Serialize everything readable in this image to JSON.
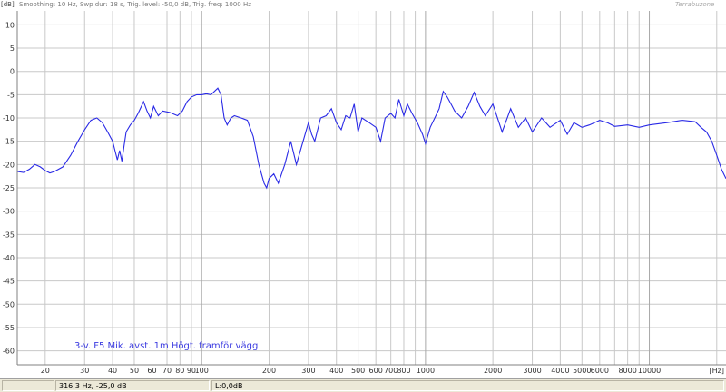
{
  "header": {
    "y_unit": "[dB]",
    "settings": "Smoothing: 10 Hz, Swp dur: 18 s, Trig. level: -50,0 dB, Trig. freq: 1000 Hz",
    "brand": "Terrabuzone"
  },
  "status": {
    "cursor": "316,3 Hz, -25,0 dB",
    "level": "L:0,0dB"
  },
  "colors": {
    "trace": "#2a2ae6",
    "grid": "#c8c8c8",
    "annotation": "#3a3ae0"
  },
  "chart_data": {
    "type": "line",
    "title": "",
    "annotation": "3-v. F5 Mik. avst. 1m Högt. framför vägg",
    "xlabel": "[Hz]",
    "ylabel": "[dB]",
    "x_scale": "log",
    "xlim": [
      15,
      22000
    ],
    "ylim": [
      -63,
      13
    ],
    "grid": true,
    "y_ticks": [
      10,
      5,
      0,
      -5,
      -10,
      -15,
      -20,
      -25,
      -30,
      -35,
      -40,
      -45,
      -50,
      -55,
      -60
    ],
    "x_ticks": [
      {
        "value": 20,
        "label": "20"
      },
      {
        "value": 30,
        "label": "30"
      },
      {
        "value": 40,
        "label": "40"
      },
      {
        "value": 50,
        "label": "50"
      },
      {
        "value": 60,
        "label": "60"
      },
      {
        "value": 70,
        "label": "70"
      },
      {
        "value": 80,
        "label": "80"
      },
      {
        "value": 90,
        "label": "90"
      },
      {
        "value": 100,
        "label": "100"
      },
      {
        "value": 200,
        "label": "200"
      },
      {
        "value": 300,
        "label": "300"
      },
      {
        "value": 400,
        "label": "400"
      },
      {
        "value": 500,
        "label": "500"
      },
      {
        "value": 600,
        "label": "600"
      },
      {
        "value": 700,
        "label": "700"
      },
      {
        "value": 800,
        "label": "800"
      },
      {
        "value": 1000,
        "label": "1000"
      },
      {
        "value": 2000,
        "label": "2000"
      },
      {
        "value": 3000,
        "label": "3000"
      },
      {
        "value": 4000,
        "label": "4000"
      },
      {
        "value": 5000,
        "label": "5000"
      },
      {
        "value": 6000,
        "label": "6000"
      },
      {
        "value": 8000,
        "label": "8000"
      },
      {
        "value": 10000,
        "label": "10000"
      }
    ],
    "series": [
      {
        "points": [
          [
            15,
            -21.5
          ],
          [
            16,
            -21.7
          ],
          [
            17,
            -21
          ],
          [
            18,
            -20
          ],
          [
            19,
            -20.5
          ],
          [
            20,
            -21.3
          ],
          [
            21,
            -21.8
          ],
          [
            22,
            -21.5
          ],
          [
            24,
            -20.5
          ],
          [
            26,
            -18
          ],
          [
            28,
            -15
          ],
          [
            30,
            -12.5
          ],
          [
            32,
            -10.5
          ],
          [
            34,
            -10
          ],
          [
            36,
            -11
          ],
          [
            38,
            -13
          ],
          [
            40,
            -15
          ],
          [
            42,
            -19
          ],
          [
            43,
            -17
          ],
          [
            44,
            -19.3
          ],
          [
            45,
            -16
          ],
          [
            46,
            -13
          ],
          [
            48,
            -11.5
          ],
          [
            50,
            -10.5
          ],
          [
            52,
            -9
          ],
          [
            55,
            -6.5
          ],
          [
            57,
            -8.5
          ],
          [
            59,
            -10
          ],
          [
            61,
            -7.5
          ],
          [
            64,
            -9.5
          ],
          [
            67,
            -8.5
          ],
          [
            72,
            -8.8
          ],
          [
            78,
            -9.5
          ],
          [
            82,
            -8.5
          ],
          [
            86,
            -6.5
          ],
          [
            90,
            -5.5
          ],
          [
            95,
            -5
          ],
          [
            100,
            -5
          ],
          [
            105,
            -4.8
          ],
          [
            110,
            -5
          ],
          [
            118,
            -3.6
          ],
          [
            122,
            -5
          ],
          [
            126,
            -10
          ],
          [
            130,
            -11.5
          ],
          [
            135,
            -10
          ],
          [
            140,
            -9.5
          ],
          [
            150,
            -10
          ],
          [
            160,
            -10.5
          ],
          [
            170,
            -14
          ],
          [
            180,
            -20
          ],
          [
            190,
            -24
          ],
          [
            195,
            -25
          ],
          [
            200,
            -23
          ],
          [
            210,
            -22
          ],
          [
            220,
            -24
          ],
          [
            235,
            -20
          ],
          [
            250,
            -15
          ],
          [
            265,
            -20
          ],
          [
            280,
            -16
          ],
          [
            300,
            -11
          ],
          [
            310,
            -13.5
          ],
          [
            320,
            -15
          ],
          [
            340,
            -10
          ],
          [
            360,
            -9.5
          ],
          [
            380,
            -8
          ],
          [
            400,
            -11
          ],
          [
            420,
            -12.5
          ],
          [
            440,
            -9.5
          ],
          [
            460,
            -10
          ],
          [
            480,
            -7
          ],
          [
            500,
            -13
          ],
          [
            520,
            -10
          ],
          [
            560,
            -11
          ],
          [
            600,
            -12
          ],
          [
            630,
            -15
          ],
          [
            660,
            -10
          ],
          [
            700,
            -9
          ],
          [
            730,
            -10
          ],
          [
            760,
            -6
          ],
          [
            800,
            -9.5
          ],
          [
            830,
            -7
          ],
          [
            870,
            -9
          ],
          [
            920,
            -11
          ],
          [
            970,
            -13.5
          ],
          [
            1000,
            -15.5
          ],
          [
            1050,
            -12
          ],
          [
            1100,
            -10
          ],
          [
            1150,
            -8
          ],
          [
            1200,
            -4.3
          ],
          [
            1250,
            -5.5
          ],
          [
            1300,
            -7
          ],
          [
            1350,
            -8.5
          ],
          [
            1450,
            -10
          ],
          [
            1550,
            -7.5
          ],
          [
            1650,
            -4.5
          ],
          [
            1750,
            -7.5
          ],
          [
            1850,
            -9.5
          ],
          [
            2000,
            -7
          ],
          [
            2200,
            -13
          ],
          [
            2400,
            -8
          ],
          [
            2600,
            -12
          ],
          [
            2800,
            -10
          ],
          [
            3000,
            -13
          ],
          [
            3300,
            -10
          ],
          [
            3600,
            -12
          ],
          [
            4000,
            -10.5
          ],
          [
            4300,
            -13.5
          ],
          [
            4600,
            -11
          ],
          [
            5000,
            -12
          ],
          [
            5400,
            -11.5
          ],
          [
            6000,
            -10.5
          ],
          [
            6500,
            -11
          ],
          [
            7000,
            -11.8
          ],
          [
            8000,
            -11.5
          ],
          [
            9000,
            -12
          ],
          [
            10000,
            -11.5
          ],
          [
            12000,
            -11
          ],
          [
            14000,
            -10.5
          ],
          [
            16000,
            -10.8
          ],
          [
            17000,
            -12
          ],
          [
            18000,
            -13
          ],
          [
            19000,
            -15
          ],
          [
            20000,
            -18
          ],
          [
            21000,
            -21
          ],
          [
            22000,
            -23
          ]
        ]
      }
    ]
  }
}
